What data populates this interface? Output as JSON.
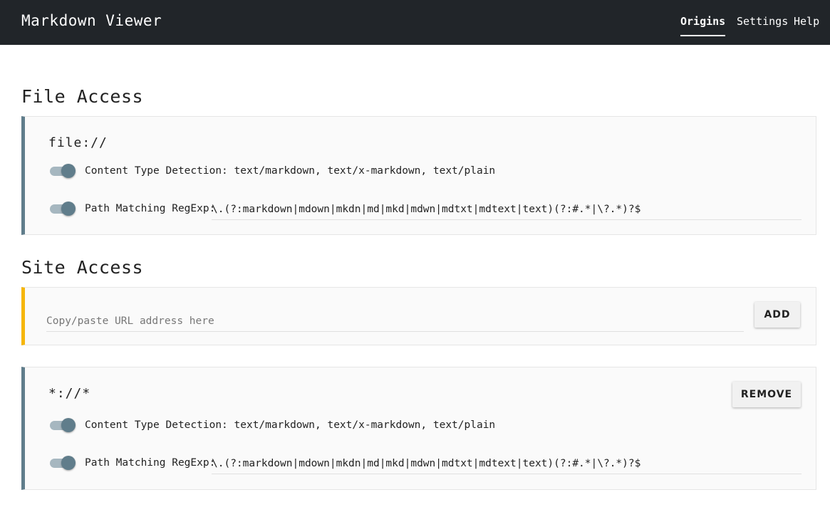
{
  "header": {
    "title": "Markdown Viewer",
    "nav": {
      "origins": "Origins",
      "settings": "Settings",
      "help": "Help"
    }
  },
  "file_access": {
    "title": "File Access",
    "origin": "file://",
    "content_type_label": "Content Type Detection: text/markdown, text/x-markdown, text/plain",
    "path_matching_label": "Path Matching RegExp:",
    "path_matching_value": "\\.(?:markdown|mdown|mkdn|md|mkd|mdwn|mdtxt|mdtext|text)(?:#.*|\\?.*)?$"
  },
  "site_access": {
    "title": "Site Access",
    "url_placeholder": "Copy/paste URL address here",
    "add_label": "Add",
    "origins": [
      {
        "origin": "*://*",
        "remove_label": "Remove",
        "content_type_label": "Content Type Detection: text/markdown, text/x-markdown, text/plain",
        "path_matching_label": "Path Matching RegExp:",
        "path_matching_value": "\\.(?:markdown|mdown|mkdn|md|mkd|mdwn|mdtxt|mdtext|text)(?:#.*|\\?.*)?$"
      }
    ]
  },
  "colors": {
    "header_bg": "#212529",
    "accent": "#607d8b",
    "pending_accent": "#f6b60a",
    "card_bg": "#fafafa"
  }
}
